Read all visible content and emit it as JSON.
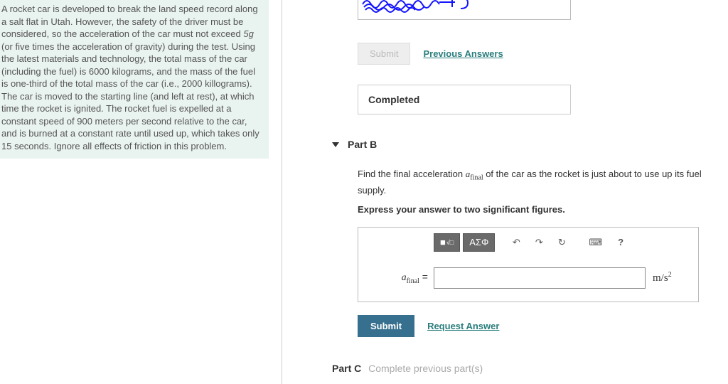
{
  "problem": {
    "text_pre": "A rocket car is developed to break the land speed record along a salt flat in Utah. However, the safety of the driver must be considered, so the acceleration of the car must not exceed ",
    "accel_limit": "5g",
    "text_post": " (or five times the acceleration of gravity) during the test. Using the latest materials and technology, the total mass of the car (including the fuel) is 6000 kilograms, and the mass of the fuel is one-third of the total mass of the car (i.e., 2000 killograms). The car is moved to the starting line (and left at rest), at which time the rocket is ignited. The rocket fuel is expelled at a constant speed of 900 meters per second relative to the car, and is burned at a constant rate until used up, which takes only 15 seconds. Ignore all effects of friction in this problem."
  },
  "partA": {
    "submit_label": "Submit",
    "previous_answers_label": "Previous Answers",
    "completed_label": "Completed"
  },
  "partB": {
    "header": "Part B",
    "prompt_pre": "Find the final acceleration ",
    "prompt_var_base": "a",
    "prompt_var_sub": "final",
    "prompt_post": " of the car as the rocket is just about to use up its fuel supply.",
    "instruction": "Express your answer to two significant figures.",
    "toolbar": {
      "templates": "■",
      "root": "√□",
      "greek": "ΑΣΦ",
      "undo": "↶",
      "redo": "↷",
      "reset": "↻",
      "keyboard": "⌨",
      "help": "?"
    },
    "answer_label_base": "a",
    "answer_label_sub": "final",
    "answer_label_eq": " =",
    "answer_value": "",
    "unit_base": "m/s",
    "unit_sup": "2",
    "submit_label": "Submit",
    "request_answer_label": "Request Answer"
  },
  "partC": {
    "label": "Part C",
    "message": "Complete previous part(s)"
  }
}
